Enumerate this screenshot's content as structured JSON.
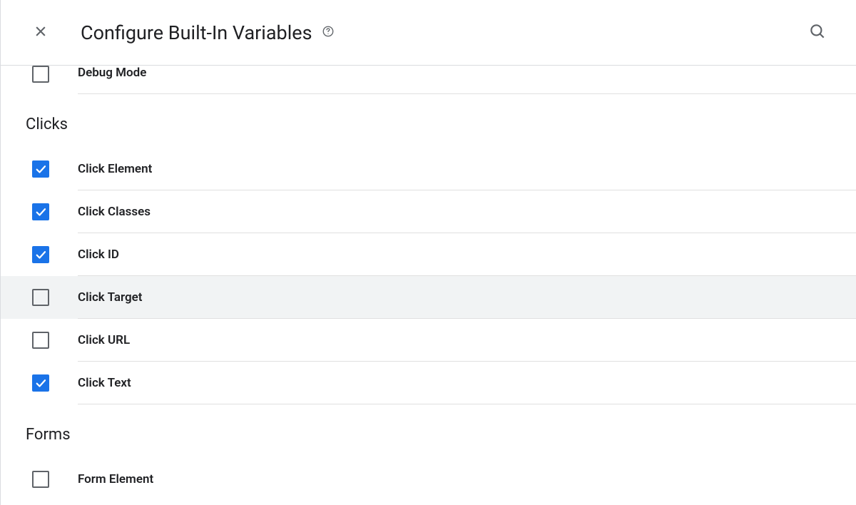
{
  "header": {
    "title": "Configure Built-In Variables"
  },
  "sections": {
    "prior_trailing": {
      "items": [
        {
          "label": "Debug Mode",
          "checked": false
        }
      ]
    },
    "clicks": {
      "title": "Clicks",
      "items": [
        {
          "label": "Click Element",
          "checked": true
        },
        {
          "label": "Click Classes",
          "checked": true
        },
        {
          "label": "Click ID",
          "checked": true
        },
        {
          "label": "Click Target",
          "checked": false,
          "hovered": true
        },
        {
          "label": "Click URL",
          "checked": false
        },
        {
          "label": "Click Text",
          "checked": true
        }
      ]
    },
    "forms": {
      "title": "Forms",
      "items": [
        {
          "label": "Form Element",
          "checked": false
        }
      ]
    }
  }
}
